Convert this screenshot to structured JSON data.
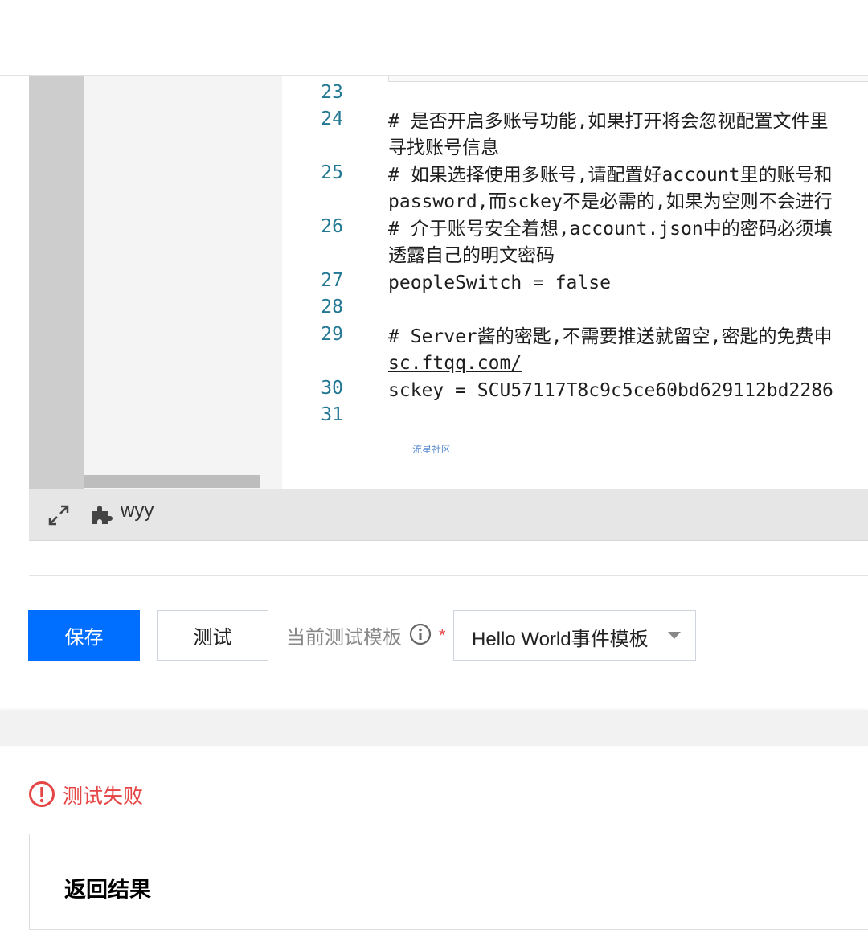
{
  "editor": {
    "lines": [
      {
        "num": "23",
        "text": ""
      },
      {
        "num": "24",
        "text": "# 是否开启多账号功能,如果打开将会忽视配置文件里"
      },
      {
        "num": "",
        "text": "寻找账号信息"
      },
      {
        "num": "25",
        "text": "# 如果选择使用多账号,请配置好account里的账号和"
      },
      {
        "num": "",
        "text": "password,而sckey不是必需的,如果为空则不会进行"
      },
      {
        "num": "26",
        "text": "# 介于账号安全着想,account.json中的密码必须填"
      },
      {
        "num": "",
        "text": "透露自己的明文密码"
      },
      {
        "num": "27",
        "text": "peopleSwitch = false"
      },
      {
        "num": "28",
        "text": ""
      },
      {
        "num": "29",
        "text": "# Server酱的密匙,不需要推送就留空,密匙的免费申"
      },
      {
        "num": "",
        "text": "sc.ftqq.com/"
      },
      {
        "num": "30",
        "text": "sckey = SCU57117T8c9c5ce60bd629112bd2286"
      },
      {
        "num": "31",
        "text": ""
      }
    ],
    "watermark": "流星社区"
  },
  "status_bar": {
    "expand_icon": "expand-icon",
    "plugin_icon": "plugin-icon",
    "user": "wyy"
  },
  "actions": {
    "save_label": "保存",
    "test_label": "测试",
    "template_label": "当前测试模板",
    "required_mark": "*",
    "template_value": "Hello World事件模板"
  },
  "result": {
    "status_text": "测试失败",
    "status_color": "#e54545",
    "section_title": "返回结果"
  },
  "colors": {
    "primary": "#006eff",
    "line_number": "#237893"
  }
}
